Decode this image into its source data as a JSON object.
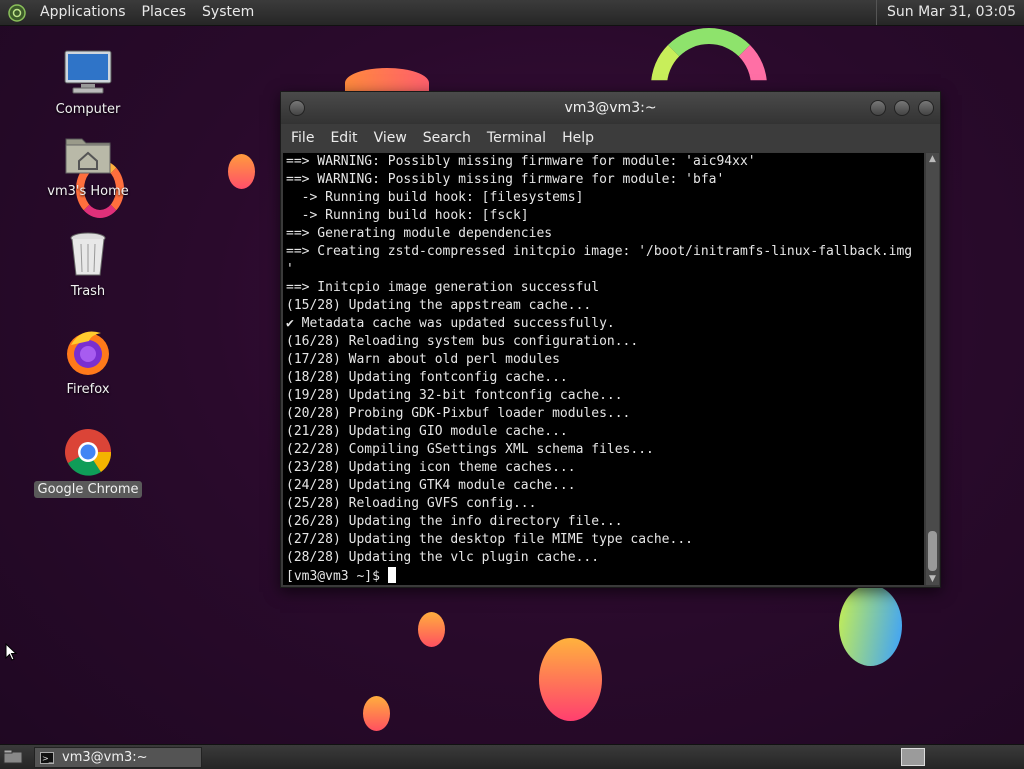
{
  "top_panel": {
    "menus": [
      "Applications",
      "Places",
      "System"
    ],
    "clock": "Sun Mar 31, 03:05"
  },
  "desktop_icons": [
    {
      "label": "Computer",
      "icon": "computer-icon"
    },
    {
      "label": "vm3's Home",
      "icon": "home-folder-icon"
    },
    {
      "label": "Trash",
      "icon": "trash-icon"
    },
    {
      "label": "Firefox",
      "icon": "firefox-icon"
    },
    {
      "label": "Google Chrome",
      "icon": "chrome-icon",
      "selected": true
    }
  ],
  "terminal": {
    "title": "vm3@vm3:~",
    "menus": [
      "File",
      "Edit",
      "View",
      "Search",
      "Terminal",
      "Help"
    ],
    "lines": [
      "==> WARNING: Possibly missing firmware for module: 'aic94xx'",
      "==> WARNING: Possibly missing firmware for module: 'bfa'",
      "  -> Running build hook: [filesystems]",
      "  -> Running build hook: [fsck]",
      "==> Generating module dependencies",
      "==> Creating zstd-compressed initcpio image: '/boot/initramfs-linux-fallback.img",
      "'",
      "==> Initcpio image generation successful",
      "(15/28) Updating the appstream cache...",
      "✔ Metadata cache was updated successfully.",
      "(16/28) Reloading system bus configuration...",
      "(17/28) Warn about old perl modules",
      "(18/28) Updating fontconfig cache...",
      "(19/28) Updating 32-bit fontconfig cache...",
      "(20/28) Probing GDK-Pixbuf loader modules...",
      "(21/28) Updating GIO module cache...",
      "(22/28) Compiling GSettings XML schema files...",
      "(23/28) Updating icon theme caches...",
      "(24/28) Updating GTK4 module cache...",
      "(25/28) Reloading GVFS config...",
      "(26/28) Updating the info directory file...",
      "(27/28) Updating the desktop file MIME type cache...",
      "(28/28) Updating the vlc plugin cache..."
    ],
    "prompt": "[vm3@vm3 ~]$ "
  },
  "taskbar": {
    "window_label": "vm3@vm3:~"
  },
  "colors": {
    "background": "#2a0a2c",
    "terminal_bg": "#000000",
    "terminal_fg": "#e6e6e6"
  }
}
